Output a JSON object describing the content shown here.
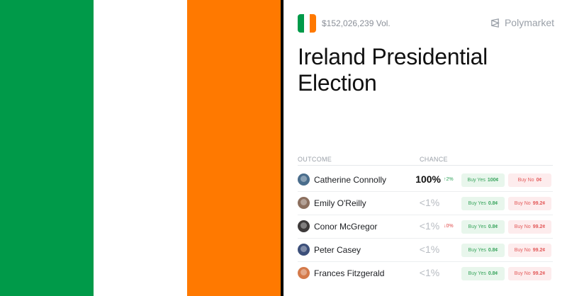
{
  "colors": {
    "flag_green": "#009a49",
    "flag_white": "#ffffff",
    "flag_orange": "#ff7900",
    "yes_text": "#3aa55e",
    "no_text": "#e35a5a"
  },
  "header": {
    "volume": "$152,026,239 Vol.",
    "brand": "Polymarket",
    "brand_icon": "polymarket-logo-icon"
  },
  "title": "Ireland Presidential Election",
  "table": {
    "col_outcome": "OUTCOME",
    "col_chance": "CHANCE",
    "rows": [
      {
        "name": "Catherine Connolly",
        "chance": "100%",
        "delta": "↑2%",
        "delta_dir": "up",
        "yes_label": "Buy Yes",
        "yes_price": "100¢",
        "no_label": "Buy No",
        "no_price": "0¢",
        "avatar_color": "#4a6d8c"
      },
      {
        "name": "Emily O'Reilly",
        "chance": "<1%",
        "delta": "",
        "delta_dir": "",
        "yes_label": "Buy Yes",
        "yes_price": "0.8¢",
        "no_label": "Buy No",
        "no_price": "99.2¢",
        "avatar_color": "#8b6f5e"
      },
      {
        "name": "Conor McGregor",
        "chance": "<1%",
        "delta": "↓0%",
        "delta_dir": "down",
        "yes_label": "Buy Yes",
        "yes_price": "0.8¢",
        "no_label": "Buy No",
        "no_price": "99.2¢",
        "avatar_color": "#3d3a3a"
      },
      {
        "name": "Peter Casey",
        "chance": "<1%",
        "delta": "",
        "delta_dir": "",
        "yes_label": "Buy Yes",
        "yes_price": "0.8¢",
        "no_label": "Buy No",
        "no_price": "99.2¢",
        "avatar_color": "#3c4f7a"
      },
      {
        "name": "Frances Fitzgerald",
        "chance": "<1%",
        "delta": "",
        "delta_dir": "",
        "yes_label": "Buy Yes",
        "yes_price": "0.8¢",
        "no_label": "Buy No",
        "no_price": "99.2¢",
        "avatar_color": "#d47a4a"
      }
    ]
  }
}
